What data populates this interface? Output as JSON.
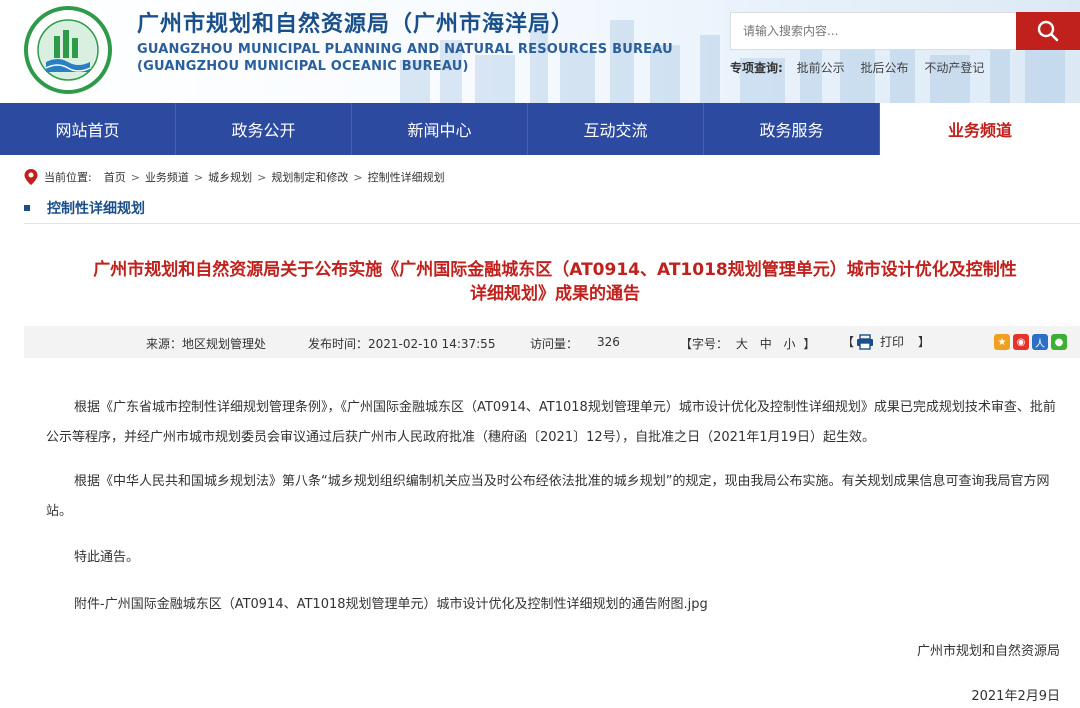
{
  "header": {
    "title_cn": "广州市规划和自然资源局（广州市海洋局）",
    "title_en_line1": "GUANGZHOU MUNICIPAL PLANNING AND NATURAL RESOURCES BUREAU",
    "title_en_line2": "(GUANGZHOU MUNICIPAL OCEANIC BUREAU)",
    "logo_icon": "bureau-emblem-icon",
    "search_placeholder": "请输入搜索内容...",
    "search_icon": "search-icon",
    "quick_label": "专项查询:",
    "quick_links": [
      "批前公示",
      "批后公布",
      "不动产登记"
    ]
  },
  "nav": {
    "items": [
      "网站首页",
      "政务公开",
      "新闻中心",
      "互动交流",
      "政务服务",
      "业务频道"
    ],
    "active_index": 5
  },
  "breadcrumb": {
    "prefix": "当前位置:",
    "items": [
      "首页",
      "业务频道",
      "城乡规划",
      "规划制定和修改",
      "控制性详细规划"
    ],
    "separator": ">"
  },
  "section": {
    "title": "控制性详细规划"
  },
  "article": {
    "title_line1": "广州市规划和自然资源局关于公布实施《广州国际金融城东区（AT0914、AT1018规划管理单元）城市设计优化及控制性",
    "title_line2": "详细规划》成果的通告",
    "meta": {
      "source": "来源：地区规划管理处",
      "published": "发布时间：2021-02-10 14:37:55",
      "visits_label": "访问量：",
      "visits": "326",
      "font_label": "【字号：",
      "font_large": "大",
      "font_medium": "中",
      "font_small": "小",
      "font_end": "】",
      "print_open": "【",
      "print_label": "打印",
      "print_close": "】"
    },
    "share_icons": [
      "qzone-share-icon",
      "weibo-share-icon",
      "renren-share-icon",
      "wechat-share-icon"
    ],
    "para1": "根据《广东省城市控制性详细规划管理条例》，《广州国际金融城东区（AT0914、AT1018规划管理单元）城市设计优化及控制性详细规划》成果已完成规划技术审查、批前公示等程序，并经广州市城市规划委员会审议通过后获广州市人民政府批准（穗府函〔2021〕12号），自批准之日（2021年1月19日）起生效。",
    "para2": "根据《中华人民共和国城乡规划法》第八条“城乡规划组织编制机关应当及时公布经依法批准的城乡规划”的规定，现由我局公布实施。有关规划成果信息可查询我局官方网站。",
    "para3": "特此通告。",
    "attachment": "附件-广州国际金融城东区（AT0914、AT1018规划管理单元）城市设计优化及控制性详细规划的通告附图.jpg",
    "signature": "广州市规划和自然资源局",
    "date": "2021年2月9日"
  }
}
